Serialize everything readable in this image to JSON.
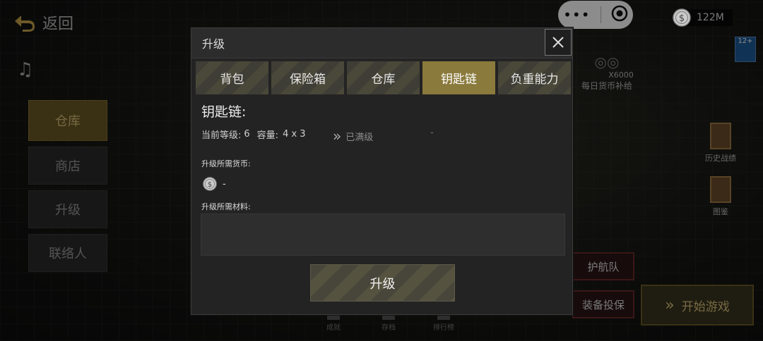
{
  "top": {
    "back_label": "返回",
    "coin_amount": "122M",
    "rating_badge": "12+"
  },
  "leftnav": {
    "items": [
      {
        "label": "仓库",
        "active": true
      },
      {
        "label": "商店",
        "active": false
      },
      {
        "label": "升级",
        "active": false
      },
      {
        "label": "联络人",
        "active": false
      }
    ]
  },
  "right": {
    "daily_amount": "X6000",
    "daily_label": "每日货币补给",
    "history_label": "历史战绩",
    "codex_label": "图鉴",
    "escort_label": "护航队",
    "supply_label": "装备投保",
    "start_label": "开始游戏"
  },
  "bottomnav": [
    "成就",
    "存档",
    "排行榜"
  ],
  "modal": {
    "header_title": "升级",
    "tabs": [
      {
        "label": "背包",
        "active": false
      },
      {
        "label": "保险箱",
        "active": false
      },
      {
        "label": "仓库",
        "active": false
      },
      {
        "label": "钥匙链",
        "active": true
      },
      {
        "label": "负重能力",
        "active": false
      }
    ],
    "section_title": "钥匙链:",
    "level_label": "当前等级:",
    "level_value": "6",
    "capacity_label": "容量:",
    "capacity_value": "4 x 3",
    "maxed_label": "已满级",
    "next_value": "-",
    "currency_label": "升级所需货币:",
    "currency_value": "-",
    "materials_label": "升级所需材料:",
    "upgrade_button": "升级"
  },
  "colors": {
    "active_tab": "#8a7a3c",
    "accent_gold": "#d9c27a",
    "panel_bg": "#232323"
  }
}
